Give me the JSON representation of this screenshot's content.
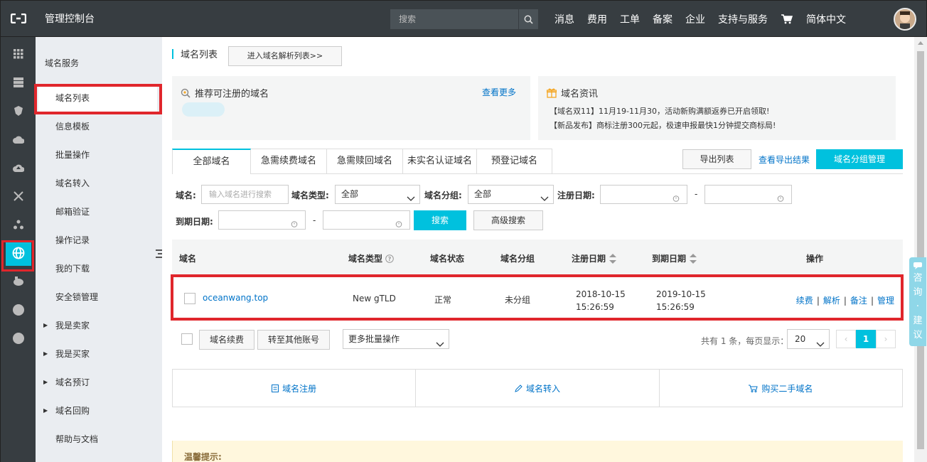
{
  "header": {
    "title": "管理控制台",
    "search_placeholder": "搜索",
    "nav": [
      "消息",
      "费用",
      "工单",
      "备案",
      "企业",
      "支持与服务"
    ],
    "language": "简体中文"
  },
  "sidebar": {
    "title": "域名服务",
    "items": [
      {
        "label": "域名列表"
      },
      {
        "label": "信息模板"
      },
      {
        "label": "批量操作"
      },
      {
        "label": "域名转入"
      },
      {
        "label": "邮箱验证"
      },
      {
        "label": "操作记录"
      },
      {
        "label": "我的下载"
      },
      {
        "label": "安全锁管理"
      },
      {
        "label": "我是卖家"
      },
      {
        "label": "我是买家"
      },
      {
        "label": "域名预订"
      },
      {
        "label": "域名回购"
      },
      {
        "label": "帮助与文档"
      }
    ]
  },
  "page": {
    "title": "域名列表",
    "resolve_button": "进入域名解析列表>>"
  },
  "recommend": {
    "title": "推荐可注册的域名",
    "more": "查看更多"
  },
  "news": {
    "title": "域名资讯",
    "lines": [
      "【域名双11】11月19-11月30，活动新购满额返券已开启领取!",
      "【新品发布】商标注册300元起，极速申报最快1分钟提交商标局!"
    ]
  },
  "tabs": [
    "全部域名",
    "急需续费域名",
    "急需赎回域名",
    "未实名认证域名",
    "预登记域名"
  ],
  "actions": {
    "export": "导出列表",
    "export_results": "查看导出结果",
    "group_manage": "域名分组管理"
  },
  "filters": {
    "domain_label": "域名:",
    "domain_placeholder": "输入域名进行搜索",
    "type_label": "域名类型:",
    "type_value": "全部",
    "group_label": "域名分组:",
    "group_value": "全部",
    "reg_date_label": "注册日期:",
    "exp_date_label": "到期日期:",
    "dash": "-",
    "search": "搜索",
    "advanced": "高级搜索"
  },
  "table": {
    "headers": [
      "域名",
      "域名类型",
      "域名状态",
      "域名分组",
      "注册日期",
      "到期日期",
      "操作"
    ],
    "rows": [
      {
        "domain": "oceanwang.top",
        "type": "New gTLD",
        "status": "正常",
        "group": "未分组",
        "reg_date": "2018-10-15",
        "reg_time": "15:26:59",
        "exp_date": "2019-10-15",
        "exp_time": "15:26:59",
        "ops": [
          "续费",
          "解析",
          "备注",
          "管理"
        ]
      }
    ]
  },
  "bulk": {
    "renew": "域名续费",
    "transfer": "转至其他账号",
    "more": "更多批量操作"
  },
  "pagination": {
    "info": "共有 1 条，每页显示：",
    "page_size": "20",
    "current": "1",
    "prev": "‹",
    "next": "›"
  },
  "quick_links": [
    "域名注册",
    "域名转入",
    "购买二手域名"
  ],
  "tip": {
    "title": "温馨提示:"
  },
  "feedback": [
    "咨",
    "询",
    "·",
    "建",
    "议"
  ],
  "colors": {
    "accent": "#00c1de",
    "link": "#0073c8",
    "highlight": "#e0262c",
    "topbar": "#373d41"
  }
}
